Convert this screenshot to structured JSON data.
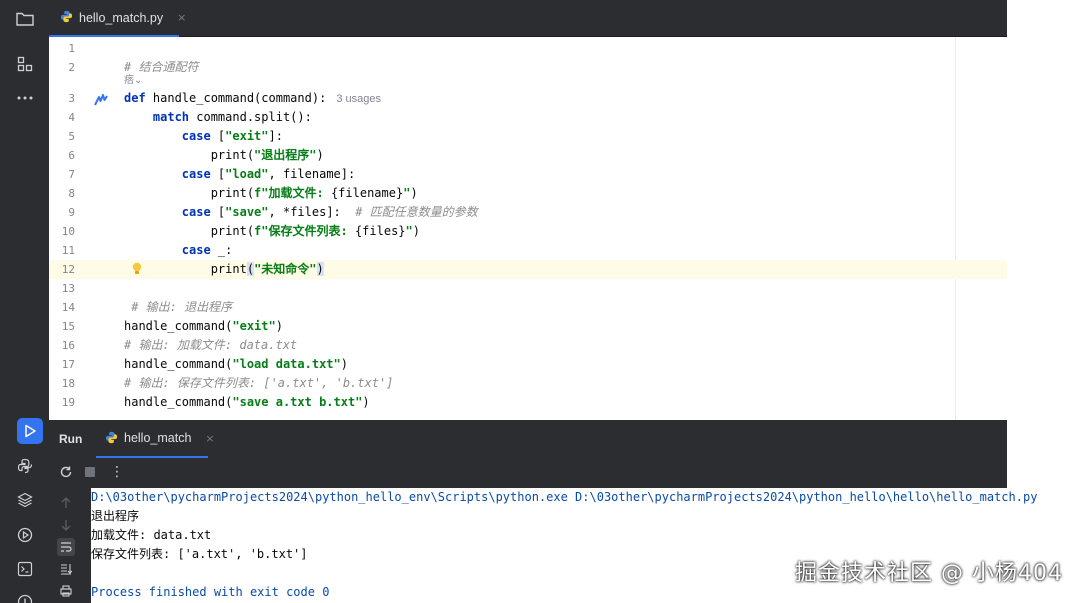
{
  "editor": {
    "tab": {
      "filename": "hello_match.py",
      "close": "×"
    },
    "annotation": "痞⌄",
    "lines": [
      {
        "n": "1",
        "parts": []
      },
      {
        "n": "2",
        "parts": [
          {
            "t": "# 结合通配符",
            "c": "cmt"
          }
        ]
      },
      {
        "n": "3",
        "parts": [
          {
            "t": "def",
            "c": "kw"
          },
          {
            "t": " handle_command(command):",
            "c": ""
          }
        ],
        "inlay": "3 usages"
      },
      {
        "n": "4",
        "parts": [
          {
            "t": "    ",
            "c": ""
          },
          {
            "t": "match",
            "c": "kw"
          },
          {
            "t": " command.split():",
            "c": ""
          }
        ]
      },
      {
        "n": "5",
        "parts": [
          {
            "t": "        ",
            "c": ""
          },
          {
            "t": "case",
            "c": "kw"
          },
          {
            "t": " [",
            "c": ""
          },
          {
            "t": "\"exit\"",
            "c": "str"
          },
          {
            "t": "]:",
            "c": ""
          }
        ]
      },
      {
        "n": "6",
        "parts": [
          {
            "t": "            print(",
            "c": ""
          },
          {
            "t": "\"退出程序\"",
            "c": "str"
          },
          {
            "t": ")",
            "c": ""
          }
        ]
      },
      {
        "n": "7",
        "parts": [
          {
            "t": "        ",
            "c": ""
          },
          {
            "t": "case",
            "c": "kw"
          },
          {
            "t": " [",
            "c": ""
          },
          {
            "t": "\"load\"",
            "c": "str"
          },
          {
            "t": ", filename]:",
            "c": ""
          }
        ]
      },
      {
        "n": "8",
        "parts": [
          {
            "t": "            print(",
            "c": ""
          },
          {
            "t": "f\"加载文件: ",
            "c": "str"
          },
          {
            "t": "{filename}",
            "c": ""
          },
          {
            "t": "\"",
            "c": "str"
          },
          {
            "t": ")",
            "c": ""
          }
        ]
      },
      {
        "n": "9",
        "parts": [
          {
            "t": "        ",
            "c": ""
          },
          {
            "t": "case",
            "c": "kw"
          },
          {
            "t": " [",
            "c": ""
          },
          {
            "t": "\"save\"",
            "c": "str"
          },
          {
            "t": ", *files]:  ",
            "c": ""
          },
          {
            "t": "# 匹配任意数量的参数",
            "c": "cmt"
          }
        ]
      },
      {
        "n": "10",
        "parts": [
          {
            "t": "            print(",
            "c": ""
          },
          {
            "t": "f\"保存文件列表: ",
            "c": "str"
          },
          {
            "t": "{files}",
            "c": ""
          },
          {
            "t": "\"",
            "c": "str"
          },
          {
            "t": ")",
            "c": ""
          }
        ]
      },
      {
        "n": "11",
        "parts": [
          {
            "t": "        ",
            "c": ""
          },
          {
            "t": "case",
            "c": "kw"
          },
          {
            "t": " _:",
            "c": ""
          }
        ]
      },
      {
        "n": "12",
        "parts": [
          {
            "t": "            print",
            "c": ""
          },
          {
            "t": "(",
            "c": "caret-sel"
          },
          {
            "t": "\"未知命令\"",
            "c": "str"
          },
          {
            "t": ")",
            "c": "caret-sel"
          }
        ],
        "current": true
      },
      {
        "n": "13",
        "parts": []
      },
      {
        "n": "14",
        "parts": [
          {
            "t": " # 输出: 退出程序",
            "c": "cmt"
          }
        ]
      },
      {
        "n": "15",
        "parts": [
          {
            "t": "handle_command(",
            "c": ""
          },
          {
            "t": "\"exit\"",
            "c": "str"
          },
          {
            "t": ")",
            "c": ""
          }
        ]
      },
      {
        "n": "16",
        "parts": [
          {
            "t": "# 输出: 加载文件: data.txt",
            "c": "cmt"
          }
        ]
      },
      {
        "n": "17",
        "parts": [
          {
            "t": "handle_command(",
            "c": ""
          },
          {
            "t": "\"load data.txt\"",
            "c": "str"
          },
          {
            "t": ")",
            "c": ""
          }
        ]
      },
      {
        "n": "18",
        "parts": [
          {
            "t": "# 输出: 保存文件列表: ['a.txt', 'b.txt']",
            "c": "cmt"
          }
        ]
      },
      {
        "n": "19",
        "parts": [
          {
            "t": "handle_command(",
            "c": ""
          },
          {
            "t": "\"save a.txt b.txt\"",
            "c": "str"
          },
          {
            "t": ")",
            "c": ""
          }
        ]
      }
    ]
  },
  "run": {
    "title": "Run",
    "tab": {
      "label": "hello_match",
      "close": "×"
    },
    "console": [
      {
        "text": "D:\\03other\\pycharmProjects2024\\python_hello_env\\Scripts\\python.exe D:\\03other\\pycharmProjects2024\\python_hello\\hello\\hello_match.py",
        "kind": "path"
      },
      {
        "text": "退出程序",
        "kind": "out"
      },
      {
        "text": "加载文件: data.txt",
        "kind": "out"
      },
      {
        "text": "保存文件列表: ['a.txt', 'b.txt']",
        "kind": "out"
      },
      {
        "text": "",
        "kind": "out"
      },
      {
        "text": "Process finished with exit code 0",
        "kind": "path"
      }
    ],
    "toolbar_more": "⋮"
  },
  "watermark": "掘金技术社区 @ 小杨404",
  "icons": {
    "left_strip": [
      "folder-icon",
      "structure-icon",
      "more-icon",
      "run-icon",
      "python-console-icon",
      "layers-icon",
      "services-icon",
      "terminal-icon",
      "problems-icon"
    ],
    "gutter": "vcs-annotate-icon",
    "bulb": "lightbulb-icon"
  },
  "colors": {
    "accent": "#3574f0",
    "keyword": "#0033b3",
    "string": "#067d17",
    "comment": "#8c8c8c",
    "current_line": "#fefbe6"
  }
}
